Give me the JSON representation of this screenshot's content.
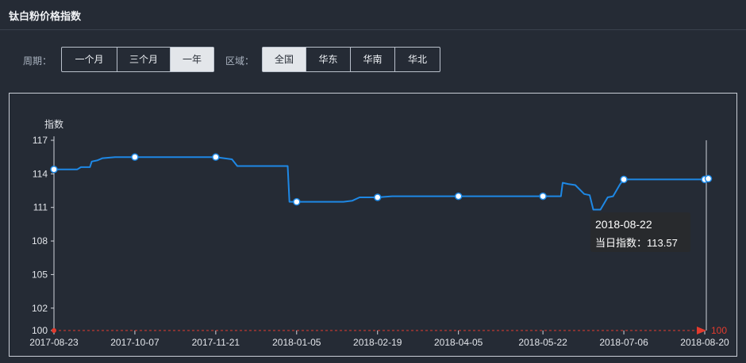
{
  "header": {
    "title": "钛白粉价格指数"
  },
  "filters": {
    "period_label": "周期：",
    "period_options": [
      {
        "label": "一个月",
        "active": false
      },
      {
        "label": "三个月",
        "active": false
      },
      {
        "label": "一年",
        "active": true
      }
    ],
    "region_label": "区域：",
    "region_options": [
      {
        "label": "全国",
        "active": true
      },
      {
        "label": "华东",
        "active": false
      },
      {
        "label": "华南",
        "active": false
      },
      {
        "label": "华北",
        "active": false
      }
    ]
  },
  "tooltip": {
    "date": "2018-08-22",
    "value_text": "当日指数：113.57"
  },
  "colors": {
    "line": "#1e88e5",
    "baseline": "#e23b2e",
    "background": "#252b35"
  },
  "chart_data": {
    "type": "line",
    "ylabel": "指数",
    "xlabel": "",
    "title": "",
    "ylim": [
      100,
      117
    ],
    "yticks": [
      100,
      102,
      105,
      108,
      111,
      114,
      117
    ],
    "xtick_labels": [
      "2017-08-23",
      "2017-10-07",
      "2017-11-21",
      "2018-01-05",
      "2018-02-19",
      "2018-04-05",
      "2018-05-22",
      "2018-07-06",
      "2018-08-20"
    ],
    "baseline": {
      "value": 100,
      "label": "100"
    },
    "series": [
      {
        "values": [
          [
            "2017-08-23",
            114.4
          ],
          [
            "2017-09-05",
            114.4
          ],
          [
            "2017-09-07",
            114.6
          ],
          [
            "2017-09-12",
            114.6
          ],
          [
            "2017-09-13",
            115.1
          ],
          [
            "2017-09-16",
            115.2
          ],
          [
            "2017-09-19",
            115.4
          ],
          [
            "2017-09-26",
            115.5
          ],
          [
            "2017-10-07",
            115.5
          ],
          [
            "2017-11-21",
            115.5
          ],
          [
            "2017-11-30",
            115.3
          ],
          [
            "2017-12-03",
            114.7
          ],
          [
            "2017-12-31",
            114.7
          ],
          [
            "2018-01-01",
            111.5
          ],
          [
            "2018-01-05",
            111.5
          ],
          [
            "2018-01-31",
            111.5
          ],
          [
            "2018-02-05",
            111.6
          ],
          [
            "2018-02-09",
            111.9
          ],
          [
            "2018-02-19",
            111.9
          ],
          [
            "2018-02-27",
            112.0
          ],
          [
            "2018-04-05",
            112.0
          ],
          [
            "2018-05-22",
            112.0
          ],
          [
            "2018-06-01",
            112.0
          ],
          [
            "2018-06-02",
            113.2
          ],
          [
            "2018-06-05",
            113.1
          ],
          [
            "2018-06-09",
            113.0
          ],
          [
            "2018-06-14",
            112.2
          ],
          [
            "2018-06-17",
            112.1
          ],
          [
            "2018-06-19",
            110.8
          ],
          [
            "2018-06-23",
            110.8
          ],
          [
            "2018-06-27",
            111.9
          ],
          [
            "2018-06-30",
            112.0
          ],
          [
            "2018-07-04",
            113.1
          ],
          [
            "2018-07-06",
            113.5
          ],
          [
            "2018-08-20",
            113.5
          ],
          [
            "2018-08-22",
            113.57
          ]
        ]
      }
    ],
    "markers": [
      [
        "2017-08-23",
        114.4
      ],
      [
        "2017-10-07",
        115.5
      ],
      [
        "2017-11-21",
        115.5
      ],
      [
        "2018-01-05",
        111.5
      ],
      [
        "2018-02-19",
        111.9
      ],
      [
        "2018-04-05",
        112.0
      ],
      [
        "2018-05-22",
        112.0
      ],
      [
        "2018-07-06",
        113.5
      ],
      [
        "2018-08-20",
        113.5
      ],
      [
        "2018-08-22",
        113.57
      ]
    ],
    "grid": false
  }
}
